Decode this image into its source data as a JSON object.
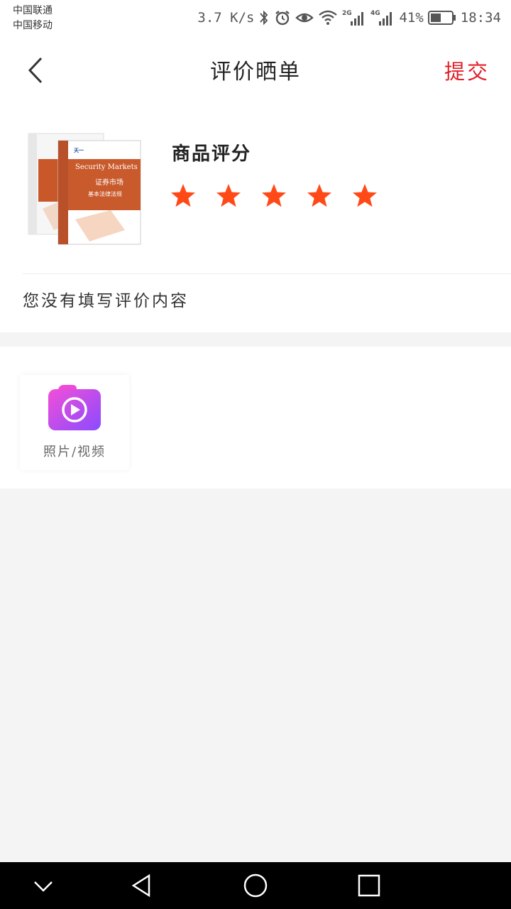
{
  "status_bar": {
    "carrier_1": "中国联通",
    "carrier_2": "中国移动",
    "net_speed": "3.7 K/s",
    "battery": "41%",
    "time": "18:34",
    "icons": [
      "bluetooth-icon",
      "alarm-icon",
      "eye-icon",
      "wifi-icon",
      "signal-2g-icon",
      "signal-4g-icon",
      "battery-icon"
    ]
  },
  "header": {
    "title": "评价晒单",
    "submit_label": "提交",
    "accent_color": "#e0202a"
  },
  "product": {
    "image_desc_name": "book-cover-image",
    "book_text": {
      "brand": "天一",
      "english_title": "Security Markets",
      "chinese_title": "证券市场",
      "chinese_subtitle": "基本法律法规"
    },
    "rating_label": "商品评分",
    "rating_value": 5,
    "rating_max": 5,
    "star_color": "#ff4a18",
    "review_placeholder": "您没有填写评价内容"
  },
  "media": {
    "upload_label": "照片/视频"
  },
  "system_nav": {
    "buttons": [
      "collapse-icon",
      "back-triangle-icon",
      "home-circle-icon",
      "recents-square-icon"
    ]
  }
}
